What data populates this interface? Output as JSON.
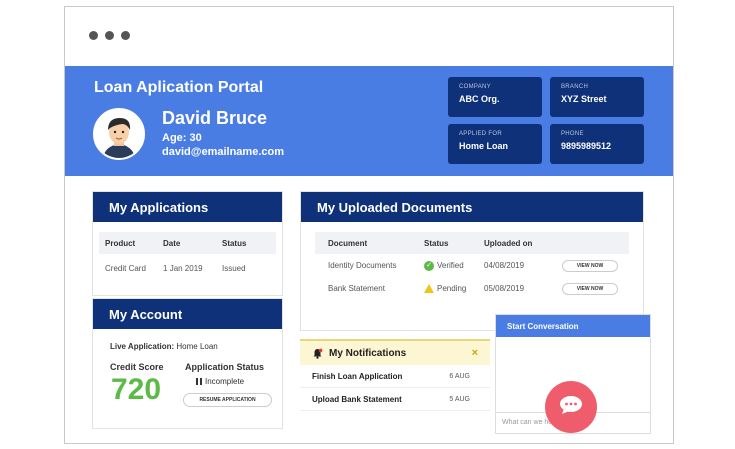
{
  "portal": {
    "title": "Loan Aplication Portal"
  },
  "user": {
    "name": "David Bruce",
    "age": "Age: 30",
    "email": "david@emailname.com"
  },
  "info": {
    "company": {
      "label": "COMPANY",
      "value": "ABC Org."
    },
    "branch": {
      "label": "BRANCH",
      "value": "XYZ Street"
    },
    "applied_for": {
      "label": "APPLIED FOR",
      "value": "Home Loan"
    },
    "phone": {
      "label": "PHONE",
      "value": "9895989512"
    }
  },
  "applications": {
    "title": "My Applications",
    "columns": [
      "Product",
      "Date",
      "Status"
    ],
    "rows": [
      {
        "product": "Credit Card",
        "date": "1 Jan 2019",
        "status": "Issued"
      }
    ]
  },
  "account": {
    "title": "My Account",
    "live_label": "Live Application:",
    "live_value": "Home Loan",
    "credit_score_label": "Credit Score",
    "credit_score": "720",
    "app_status_label": "Application Status",
    "app_status": "Incomplete",
    "resume_label": "RESUME APPLICATION"
  },
  "documents": {
    "title": "My Uploaded Documents",
    "columns": [
      "Document",
      "Status",
      "Uploaded on"
    ],
    "view_label": "VIEW NOW",
    "rows": [
      {
        "document": "Identity Documents",
        "status": "Verified",
        "date": "04/08/2019"
      },
      {
        "document": "Bank Statement",
        "status": "Pending",
        "date": "05/08/2019"
      }
    ]
  },
  "notifications": {
    "title": "My Notifications",
    "close": "×",
    "items": [
      {
        "text": "Finish Loan Application",
        "date": "6 AUG"
      },
      {
        "text": "Upload Bank Statement",
        "date": "5 AUG"
      }
    ]
  },
  "conversation": {
    "title": "Start Conversation",
    "placeholder": "What can we help you with?"
  },
  "colors": {
    "header": "#4a7de3",
    "navy": "#0f3179",
    "score": "#5cba47",
    "fab": "#ef5d6d"
  }
}
